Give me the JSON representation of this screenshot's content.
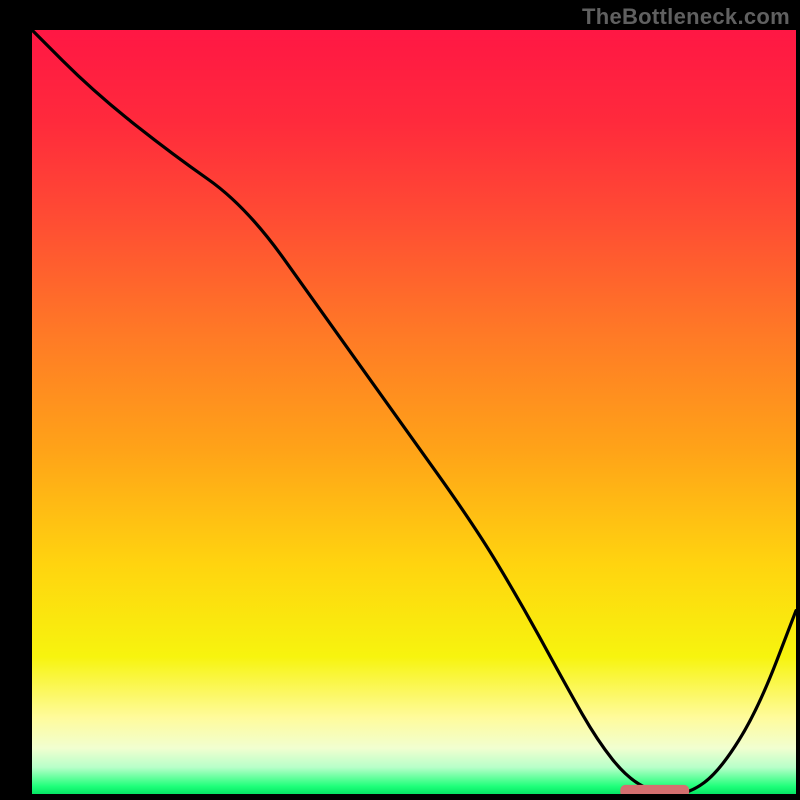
{
  "watermark": "TheBottleneck.com",
  "colors": {
    "frame_bg": "#000000",
    "watermark_text": "#606060",
    "curve": "#000000",
    "marker": "#d47070",
    "gradient_stops": [
      {
        "offset": 0.0,
        "color": "#ff1744"
      },
      {
        "offset": 0.12,
        "color": "#ff2a3c"
      },
      {
        "offset": 0.25,
        "color": "#ff4d33"
      },
      {
        "offset": 0.4,
        "color": "#ff7a26"
      },
      {
        "offset": 0.55,
        "color": "#ffa318"
      },
      {
        "offset": 0.7,
        "color": "#ffd40f"
      },
      {
        "offset": 0.82,
        "color": "#f7f40e"
      },
      {
        "offset": 0.9,
        "color": "#fffb9c"
      },
      {
        "offset": 0.94,
        "color": "#f1ffd0"
      },
      {
        "offset": 0.965,
        "color": "#b8ffc9"
      },
      {
        "offset": 0.99,
        "color": "#1fff7a"
      },
      {
        "offset": 1.0,
        "color": "#05e664"
      }
    ]
  },
  "chart_data": {
    "type": "line",
    "title": "",
    "xlabel": "",
    "ylabel": "",
    "xlim": [
      0,
      100
    ],
    "ylim": [
      0,
      100
    ],
    "grid": false,
    "legend": false,
    "series": [
      {
        "name": "bottleneck-curve",
        "x": [
          0,
          8,
          18,
          28,
          38,
          48,
          58,
          64,
          70,
          74,
          78,
          82,
          86,
          90,
          95,
          100
        ],
        "y": [
          100,
          92,
          84,
          77,
          63,
          49,
          35,
          25,
          14,
          7,
          2,
          0,
          0,
          3,
          11,
          24
        ]
      }
    ],
    "marker": {
      "x_start": 77,
      "x_end": 86,
      "y": 0.4
    }
  }
}
